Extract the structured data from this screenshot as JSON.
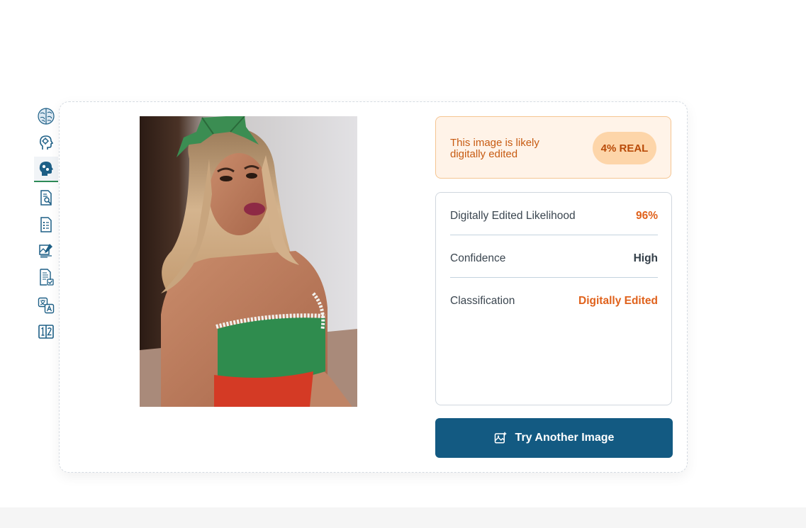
{
  "sidebar": {
    "tools": [
      {
        "icon": "brain-icon"
      },
      {
        "icon": "head-profile-icon"
      },
      {
        "icon": "head-puzzle-icon",
        "active": true
      },
      {
        "icon": "document-search-icon"
      },
      {
        "icon": "document-list-icon"
      },
      {
        "icon": "image-edit-icon"
      },
      {
        "icon": "document-check-icon"
      },
      {
        "icon": "translate-icon"
      },
      {
        "icon": "compare-numbers-icon"
      }
    ]
  },
  "result": {
    "verdict_text": "This image is likely digitally edited",
    "verdict_badge": "4% REAL",
    "stats": [
      {
        "label": "Digitally Edited Likelihood",
        "value": "96%",
        "color": "#e0621c"
      },
      {
        "label": "Confidence",
        "value": "High",
        "color": "#333e48"
      },
      {
        "label": "Classification",
        "value": "Digitally Edited",
        "color": "#e0621c"
      }
    ],
    "try_another_label": "Try Another Image"
  },
  "colors": {
    "primary": "#135a82",
    "accent_orange": "#e0621c",
    "banner_bg": "#fff3e8",
    "active_indicator": "#2e8b57"
  }
}
